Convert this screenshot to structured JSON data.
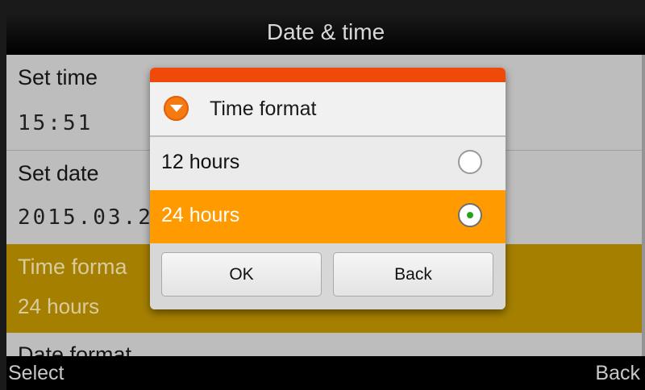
{
  "header": {
    "title": "Date & time"
  },
  "list": {
    "items": [
      {
        "title": "Set time",
        "value": "15:51"
      },
      {
        "title": "Set date",
        "value": "2015.03.2"
      },
      {
        "title": "Time forma",
        "value": "24 hours"
      },
      {
        "title": "Date format"
      }
    ]
  },
  "dialog": {
    "title": "Time format",
    "icon": "chevron-down-circle-icon",
    "options": [
      {
        "label": "12 hours",
        "selected": false
      },
      {
        "label": "24 hours",
        "selected": true
      }
    ],
    "ok_label": "OK",
    "back_label": "Back"
  },
  "softkeys": {
    "left": "Select",
    "right": "Back"
  },
  "colors": {
    "accent_orange": "#ff9a00",
    "dialog_accent": "#f04a0a",
    "highlight_row": "#b08700",
    "radio_selected": "#27a31b"
  }
}
